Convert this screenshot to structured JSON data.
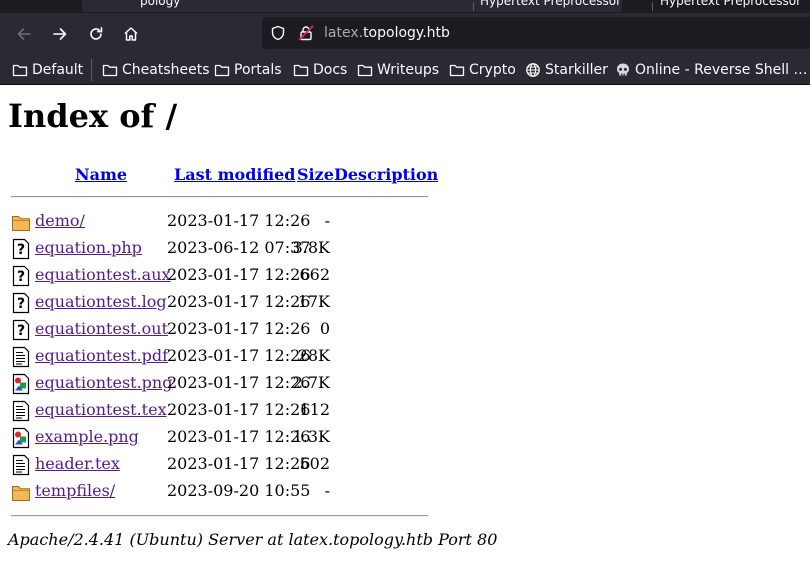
{
  "browser": {
    "tab_fragments": [
      "pology",
      "Hypertext Preprocessor",
      "Hypertext Preprocessor"
    ],
    "url_subdomain": "latex.",
    "url_domain": "topology.htb",
    "bookmarks": [
      {
        "label": "Default",
        "icon": "folder-icon"
      },
      {
        "label": "Cheatsheets",
        "icon": "folder-icon"
      },
      {
        "label": "Portals",
        "icon": "folder-icon"
      },
      {
        "label": "Docs",
        "icon": "folder-icon"
      },
      {
        "label": "Writeups",
        "icon": "folder-icon"
      },
      {
        "label": "Crypto",
        "icon": "folder-icon"
      },
      {
        "label": "Starkiller",
        "icon": "globe-icon"
      },
      {
        "label": "Online - Reverse Shell …",
        "icon": "skull-icon"
      }
    ]
  },
  "page": {
    "title": "Index of /",
    "columns": {
      "name": "Name",
      "last_modified": "Last modified",
      "size": "Size",
      "description": "Description"
    },
    "files": [
      {
        "name": "demo/",
        "modified": "2023-01-17 12:26",
        "size": "-",
        "icon": "folder-icon"
      },
      {
        "name": "equation.php",
        "modified": "2023-06-12 07:37",
        "size": "3.8K",
        "icon": "unknown-file-icon"
      },
      {
        "name": "equationtest.aux",
        "modified": "2023-01-17 12:26",
        "size": "662",
        "icon": "unknown-file-icon"
      },
      {
        "name": "equationtest.log",
        "modified": "2023-01-17 12:26",
        "size": "17K",
        "icon": "unknown-file-icon"
      },
      {
        "name": "equationtest.out",
        "modified": "2023-01-17 12:26",
        "size": "0",
        "icon": "unknown-file-icon"
      },
      {
        "name": "equationtest.pdf",
        "modified": "2023-01-17 12:26",
        "size": "28K",
        "icon": "text-file-icon"
      },
      {
        "name": "equationtest.png",
        "modified": "2023-01-17 12:26",
        "size": "2.7K",
        "icon": "image-file-icon"
      },
      {
        "name": "equationtest.tex",
        "modified": "2023-01-17 12:26",
        "size": "112",
        "icon": "text-file-icon"
      },
      {
        "name": "example.png",
        "modified": "2023-01-17 12:26",
        "size": "1.3K",
        "icon": "image-file-icon"
      },
      {
        "name": "header.tex",
        "modified": "2023-01-17 12:26",
        "size": "502",
        "icon": "text-file-icon"
      },
      {
        "name": "tempfiles/",
        "modified": "2023-09-20 10:55",
        "size": "-",
        "icon": "folder-icon"
      }
    ],
    "footer": "Apache/2.4.41 (Ubuntu) Server at latex.topology.htb Port 80"
  }
}
